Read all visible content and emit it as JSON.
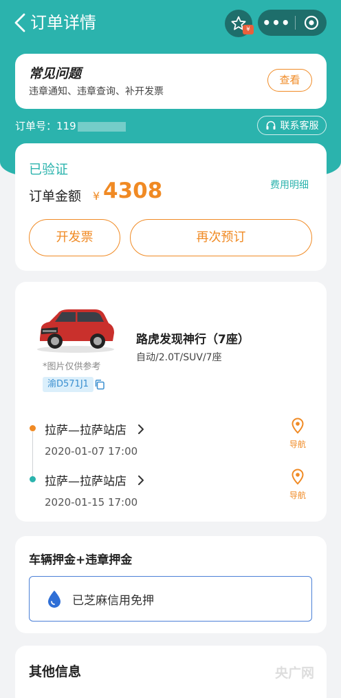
{
  "nav": {
    "title": "订单详情",
    "fav_badge": "¥"
  },
  "faq": {
    "title": "常见问题",
    "subtitle": "违章通知、违章查询、补开发票",
    "view_label": "查看"
  },
  "order": {
    "number_label": "订单号：",
    "number_prefix": "119",
    "service_label": "联系客服"
  },
  "status": {
    "title": "已验证",
    "amount_label": "订单金额",
    "currency": "¥",
    "amount": "4308",
    "fee_detail_label": "费用明细",
    "invoice_label": "开发票",
    "rebook_label": "再次预订"
  },
  "car": {
    "note": "*图片仅供参考",
    "plate": "渝D571J1",
    "name": "路虎发现神行（7座）",
    "spec": "自动/2.0T/SUV/7座"
  },
  "trip": {
    "pickup": {
      "location": "拉萨—拉萨站店",
      "time": "2020-01-07 17:00",
      "nav_label": "导航"
    },
    "return": {
      "location": "拉萨—拉萨站店",
      "time": "2020-01-15 17:00",
      "nav_label": "导航"
    }
  },
  "deposit": {
    "title": "车辆押金+违章押金",
    "status": "已芝麻信用免押"
  },
  "other": {
    "title": "其他信息"
  },
  "watermark": "央广网",
  "colors": {
    "teal": "#2bb3ad",
    "orange": "#f08a24",
    "blue": "#4a7fd6"
  }
}
